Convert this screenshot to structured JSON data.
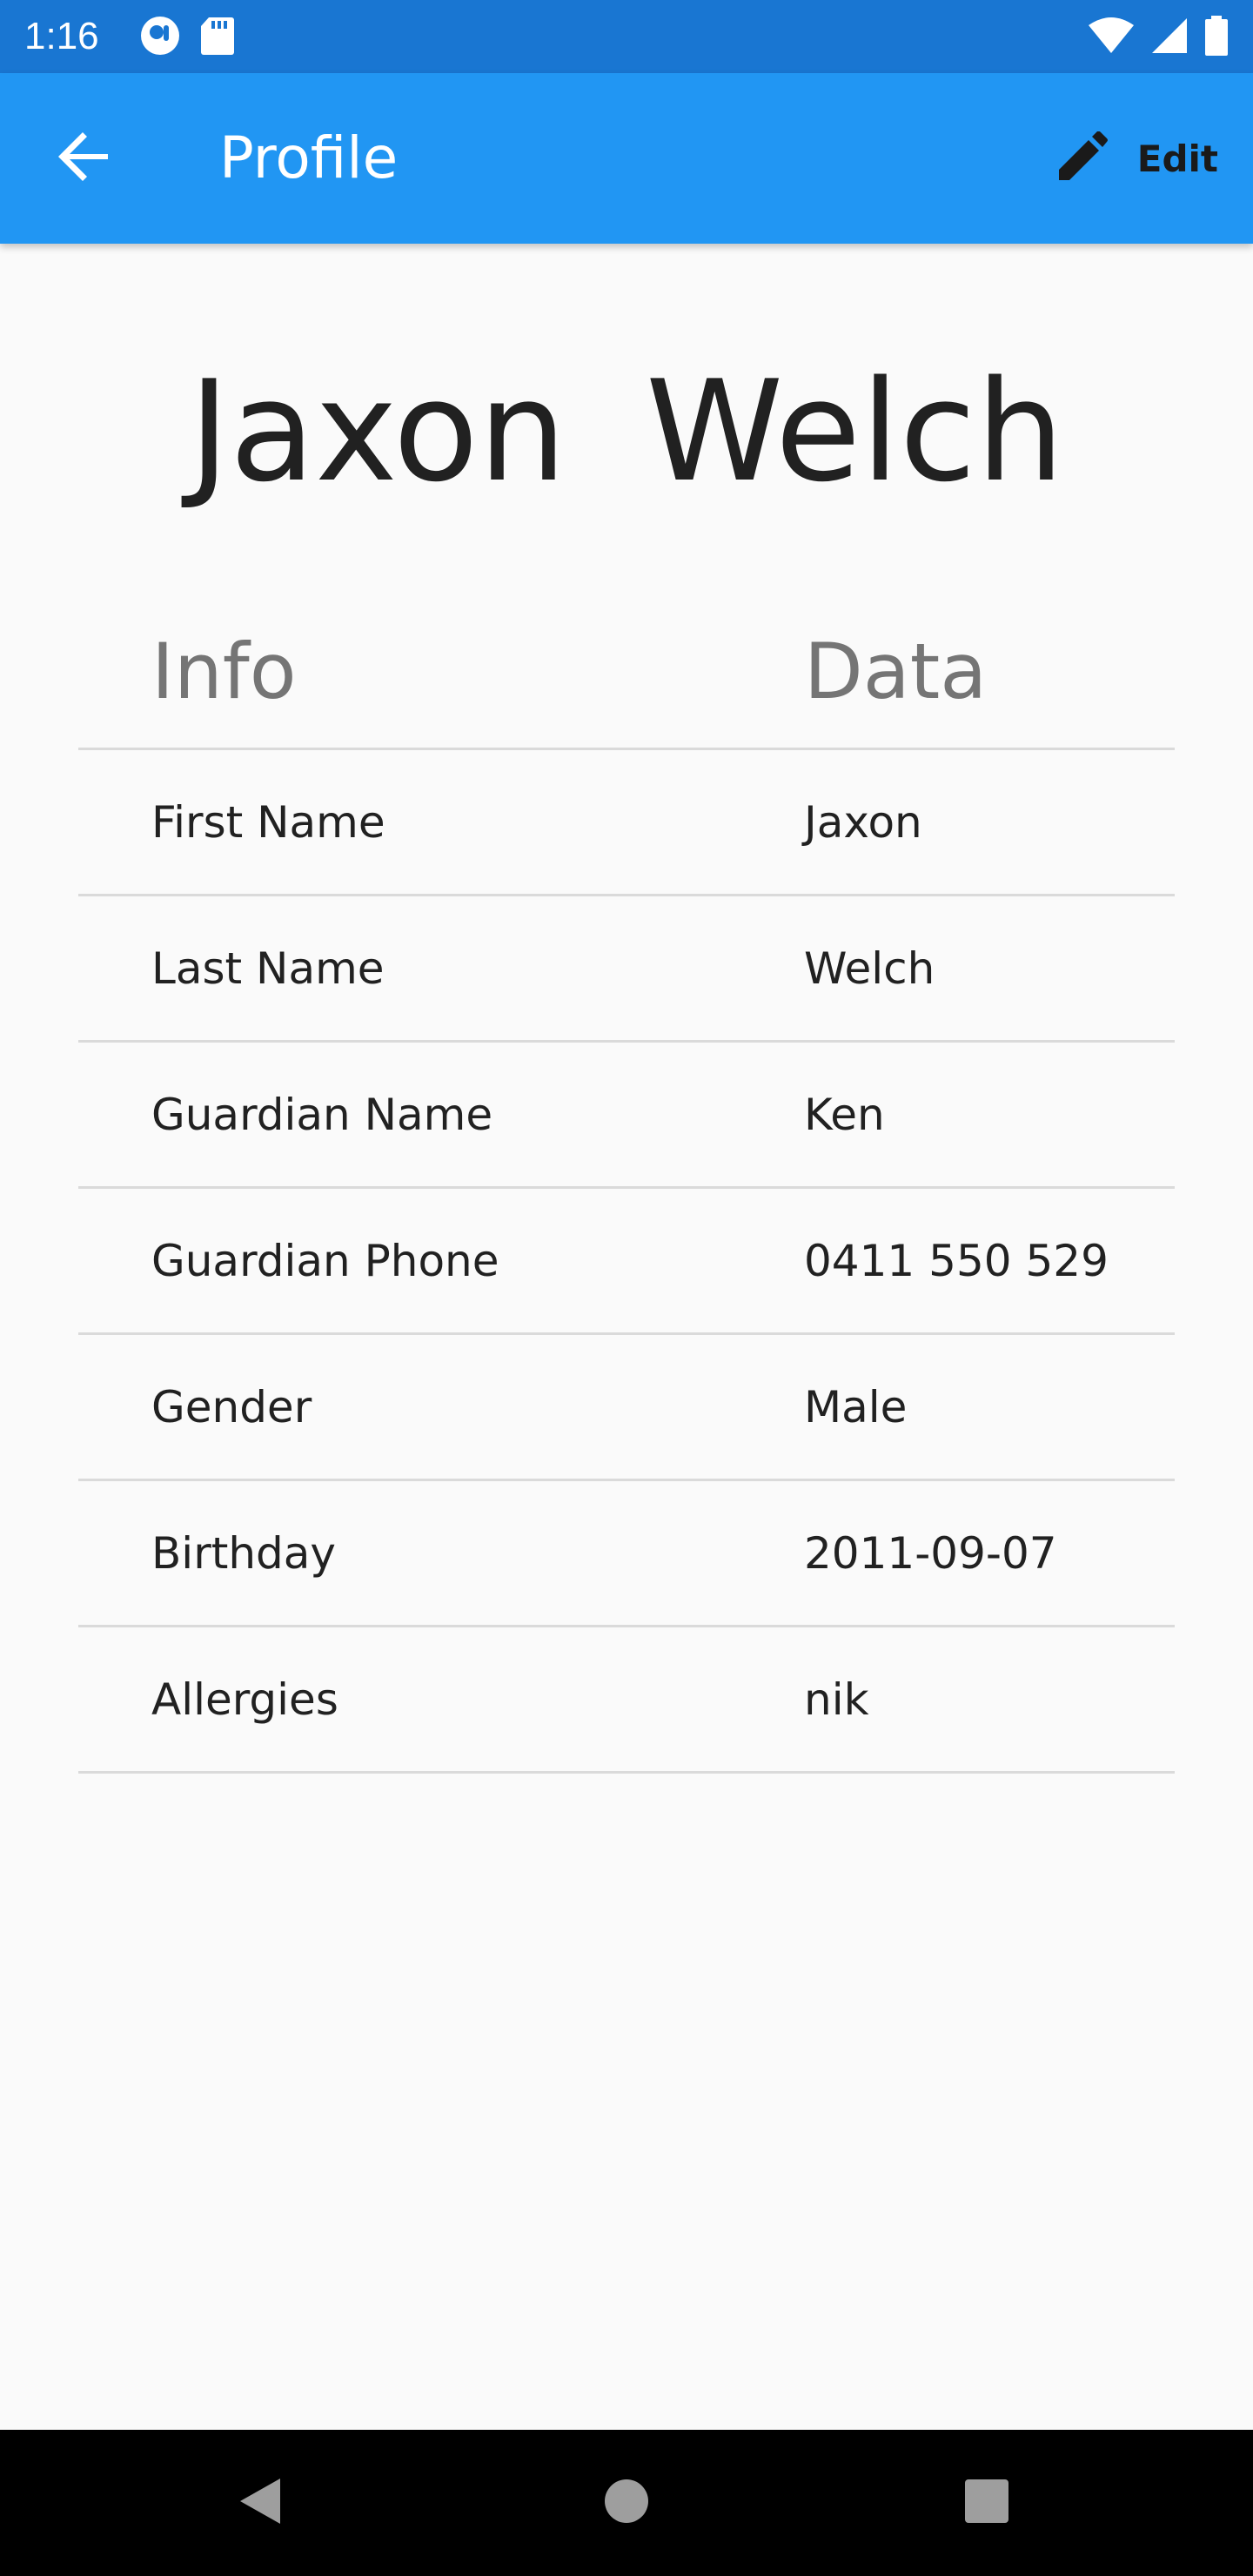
{
  "status_bar": {
    "time": "1:16",
    "left_icons": [
      "record-icon",
      "sd-card-icon"
    ],
    "right_icons": [
      "wifi-icon",
      "signal-icon",
      "battery-icon"
    ]
  },
  "app_bar": {
    "title": "Profile",
    "back_icon": "arrow-back-icon",
    "edit_icon": "pencil-icon",
    "edit_label": "Edit",
    "background": "#2196F3",
    "status_background": "#1976D2"
  },
  "profile": {
    "first_name": "Jaxon",
    "last_name": "Welch"
  },
  "table": {
    "headers": [
      "Info",
      "Data"
    ],
    "rows": [
      {
        "info": "First Name",
        "data": "Jaxon"
      },
      {
        "info": "Last Name",
        "data": "Welch"
      },
      {
        "info": "Guardian Name",
        "data": "Ken"
      },
      {
        "info": "Guardian Phone",
        "data": "0411 550 529"
      },
      {
        "info": "Gender",
        "data": "Male"
      },
      {
        "info": "Birthday",
        "data": "2011-09-07"
      },
      {
        "info": "Allergies",
        "data": "nik"
      }
    ]
  },
  "nav_bar": {
    "icons": [
      "back-triangle-icon",
      "home-circle-icon",
      "recents-square-icon"
    ]
  }
}
